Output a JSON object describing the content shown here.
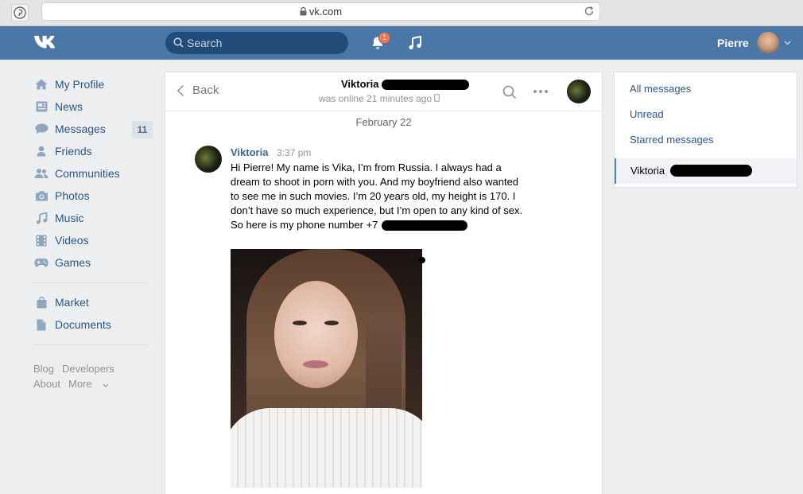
{
  "browser": {
    "url": "vk.com"
  },
  "header": {
    "search_placeholder": "Search",
    "notification_count": "1",
    "username": "Pierre"
  },
  "nav": {
    "items": [
      {
        "label": "My Profile",
        "icon": "home-icon"
      },
      {
        "label": "News",
        "icon": "news-icon"
      },
      {
        "label": "Messages",
        "icon": "messages-icon",
        "count": "11"
      },
      {
        "label": "Friends",
        "icon": "friends-icon"
      },
      {
        "label": "Communities",
        "icon": "communities-icon"
      },
      {
        "label": "Photos",
        "icon": "camera-icon"
      },
      {
        "label": "Music",
        "icon": "music-icon"
      },
      {
        "label": "Videos",
        "icon": "video-icon"
      },
      {
        "label": "Games",
        "icon": "gamepad-icon"
      }
    ],
    "extra": [
      {
        "label": "Market",
        "icon": "bag-icon"
      },
      {
        "label": "Documents",
        "icon": "document-icon"
      }
    ],
    "footer": [
      "Blog",
      "Developers",
      "About",
      "More"
    ]
  },
  "chat": {
    "back_label": "Back",
    "peer_name": "Viktoria",
    "peer_status": "was online 21 minutes ago",
    "date": "February 22",
    "message": {
      "author": "Viktoria",
      "time": "3:37 pm",
      "lines": [
        "Hi Pierre! My name is Vika, I’m from Russia. I always had a",
        "dream to shoot in porn with you. And my boyfriend also wanted",
        "to see me in such movies. I’m 20 years old, my height is 170. I",
        "don’t have so much experience, but I’m open to any kind of sex.",
        "So here is my phone number +7"
      ]
    }
  },
  "right_panel": {
    "all_messages": "All messages",
    "unread": "Unread",
    "starred": "Starred messages",
    "active_conversation": "Viktoria"
  },
  "colors": {
    "vk_blue": "#4a76a8",
    "link": "#2a5885",
    "page_bg": "#edeef0"
  }
}
